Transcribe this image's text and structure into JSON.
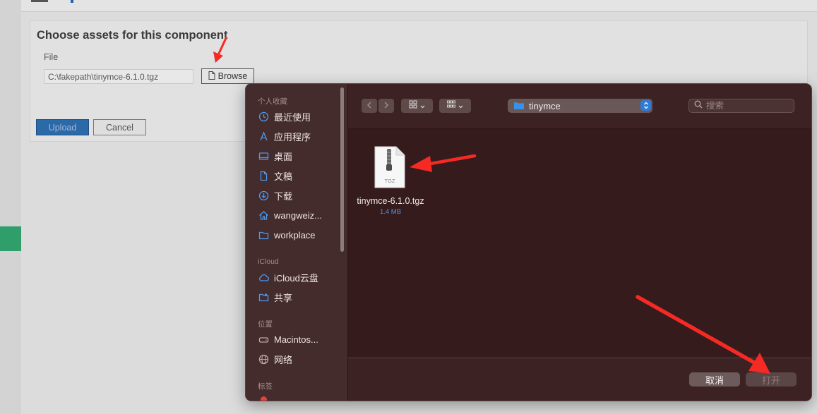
{
  "page": {
    "panel_title": "Choose assets for this component",
    "file_label": "File",
    "file_path": "C:\\fakepath\\tinymce-6.1.0.tgz",
    "browse_label": "Browse",
    "upload_label": "Upload",
    "cancel_label": "Cancel"
  },
  "dialog": {
    "sidebar": {
      "sections": [
        {
          "title": "个人收藏",
          "items": [
            {
              "label": "最近使用",
              "icon": "clock-icon"
            },
            {
              "label": "应用程序",
              "icon": "applications-icon"
            },
            {
              "label": "桌面",
              "icon": "desktop-icon"
            },
            {
              "label": "文稿",
              "icon": "document-icon"
            },
            {
              "label": "下载",
              "icon": "download-icon"
            },
            {
              "label": "wangweiz...",
              "icon": "home-icon"
            },
            {
              "label": "workplace",
              "icon": "folder-icon"
            }
          ]
        },
        {
          "title": "iCloud",
          "items": [
            {
              "label": "iCloud云盘",
              "icon": "cloud-icon"
            },
            {
              "label": "共享",
              "icon": "shared-folder-icon"
            }
          ]
        },
        {
          "title": "位置",
          "items": [
            {
              "label": "Macintos...",
              "icon": "disk-icon"
            },
            {
              "label": "网络",
              "icon": "globe-icon"
            }
          ]
        },
        {
          "title": "标签",
          "items": []
        }
      ]
    },
    "toolbar": {
      "location": "tinymce",
      "search_placeholder": "搜索"
    },
    "file": {
      "name": "tinymce-6.1.0.tgz",
      "size": "1.4 MB",
      "type_label": "TGZ"
    },
    "footer": {
      "cancel_label": "取消",
      "open_label": "打开"
    }
  },
  "colors": {
    "accent": "#2e7cd8",
    "annotation_arrow": "#f52a24",
    "upload_button": "#2c69a8"
  }
}
